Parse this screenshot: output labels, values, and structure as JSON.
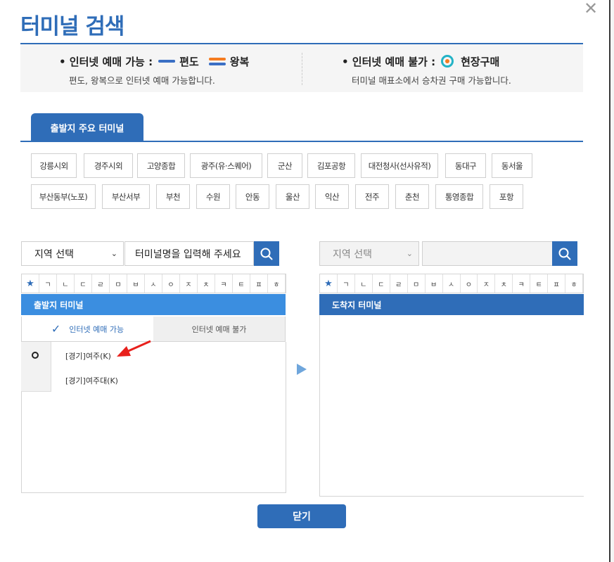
{
  "dialog": {
    "title": "터미널 검색",
    "close_glyph": "✕"
  },
  "legend": {
    "left": {
      "heading": "• 인터넷 예매 가능 :",
      "oneway": "편도",
      "roundtrip": "왕복",
      "desc": "편도, 왕복으로 인터넷 예매 가능합니다."
    },
    "right": {
      "heading": "• 인터넷 예매 불가 :",
      "onsite": "현장구매",
      "desc": "터미널 매표소에서 승차권 구매 가능합니다."
    },
    "colors": {
      "oneway": "#3a6fc4",
      "roundtrip_top": "#f57c20",
      "roundtrip_bottom": "#3a6fc4",
      "onsite_ring": "#23b3c6",
      "onsite_dot": "#f57c20"
    }
  },
  "major_terminals": {
    "tab_label": "출발지 주요 터미널",
    "row1": [
      "강릉시외",
      "경주시외",
      "고양종합",
      "광주(유·스퀘어)",
      "군산",
      "김포공항",
      "대전청사(선사유적)",
      "동대구",
      "동서울"
    ],
    "row2": [
      "부산동부(노포)",
      "부산서부",
      "부천",
      "수원",
      "안동",
      "울산",
      "익산",
      "전주",
      "춘천",
      "통영종합",
      "포항"
    ]
  },
  "departure": {
    "region_select": "지역 선택",
    "search_placeholder": "터미널명을 입력해 주세요",
    "panel_title": "출발지 터미널",
    "tab_available": "인터넷 예매 가능",
    "tab_unavailable": "인터넷 예매 불가",
    "items": [
      "[경기]여주(K)",
      "[경기]여주대(K)"
    ]
  },
  "arrival": {
    "region_select": "지역 선택",
    "search_placeholder": "",
    "panel_title": "도착지 터미널"
  },
  "consonants": [
    "★",
    "ㄱ",
    "ㄴ",
    "ㄷ",
    "ㄹ",
    "ㅁ",
    "ㅂ",
    "ㅅ",
    "ㅇ",
    "ㅈ",
    "ㅊ",
    "ㅋ",
    "ㅌ",
    "ㅍ",
    "ㅎ"
  ],
  "footer": {
    "close_label": "닫기"
  },
  "accent": "#2f6db8",
  "header_light": "#3b8ee0"
}
